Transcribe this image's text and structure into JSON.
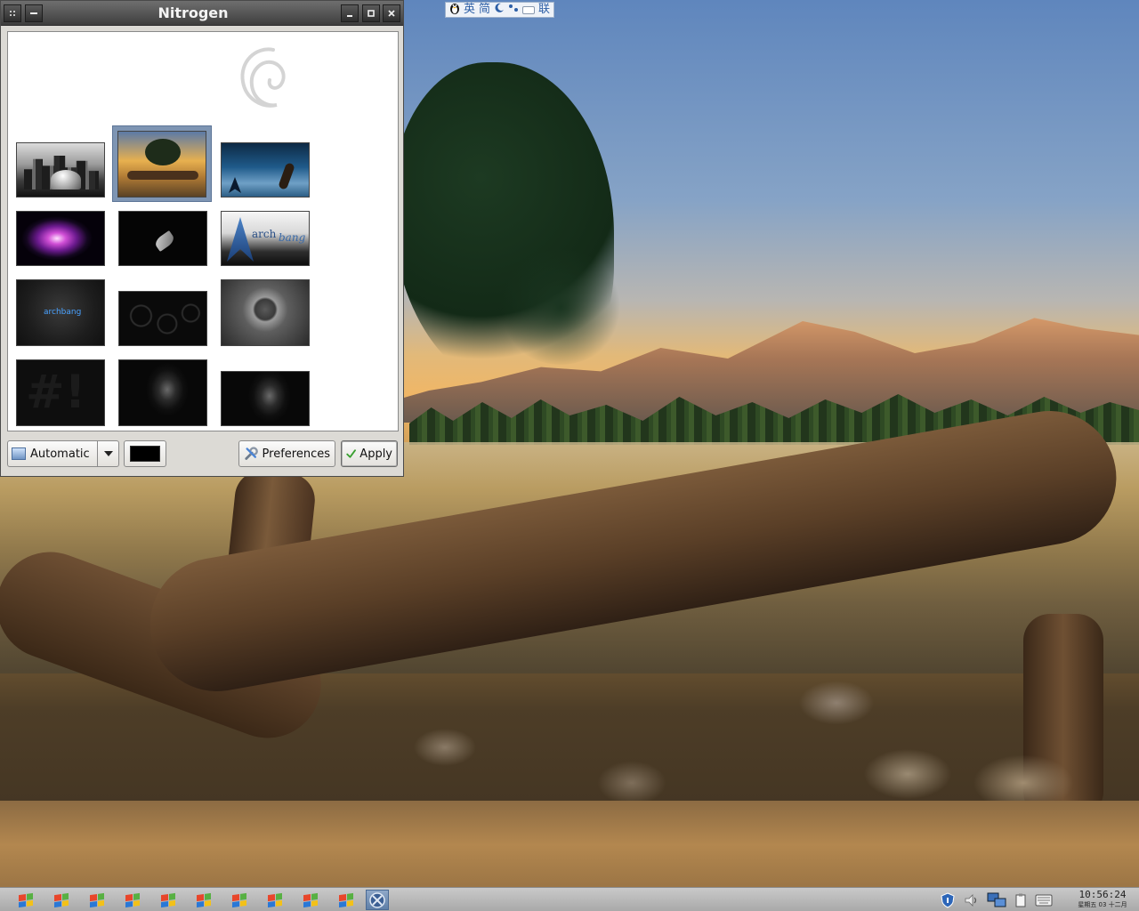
{
  "ime_bar": {
    "lang_label": "英",
    "mode_label": "简",
    "assoc_label": "联",
    "icons": [
      "penguin-icon",
      "moon-icon",
      "punctuation-icon",
      "keyboard-icon"
    ]
  },
  "window": {
    "title": "Nitrogen",
    "titlebar_buttons": [
      "menu",
      "shade",
      "minimize",
      "maximize",
      "close"
    ],
    "thumbnails": [
      {
        "name": "chicago-bean-wallpaper",
        "selected": false
      },
      {
        "name": "tree-lake-wallpaper",
        "selected": true
      },
      {
        "name": "arch-underwater-guitar-wallpaper",
        "selected": false
      },
      {
        "name": "purple-nebula-wallpaper",
        "selected": false
      },
      {
        "name": "dark-leaf-wallpaper",
        "selected": false
      },
      {
        "name": "archbang-logo-wallpaper",
        "selected": false,
        "text": "arch",
        "text2": "bang"
      },
      {
        "name": "archbang-dark-wallpaper",
        "selected": false,
        "text": "archbang"
      },
      {
        "name": "debian-swirls-wallpaper",
        "selected": false
      },
      {
        "name": "dark-sphere-wallpaper",
        "selected": false
      },
      {
        "name": "crunchbang-hash-wallpaper",
        "selected": false
      },
      {
        "name": "dark-crux-wallpaper",
        "selected": false
      },
      {
        "name": "dark-crux-small-wallpaper",
        "selected": false
      }
    ],
    "mode_select": {
      "value": "Automatic"
    },
    "bg_color": "#000000",
    "preferences_label": "Preferences",
    "apply_label": "Apply"
  },
  "taskbar": {
    "task_count": 10,
    "active_task_icon": "crossed-circle-icon",
    "tray_icons": [
      "shield-icon",
      "volume-icon",
      "network-icon",
      "clipboard-icon",
      "keyboard-icon"
    ],
    "clock_time": "10:56:24",
    "clock_date": "星期五 03 十二月"
  }
}
